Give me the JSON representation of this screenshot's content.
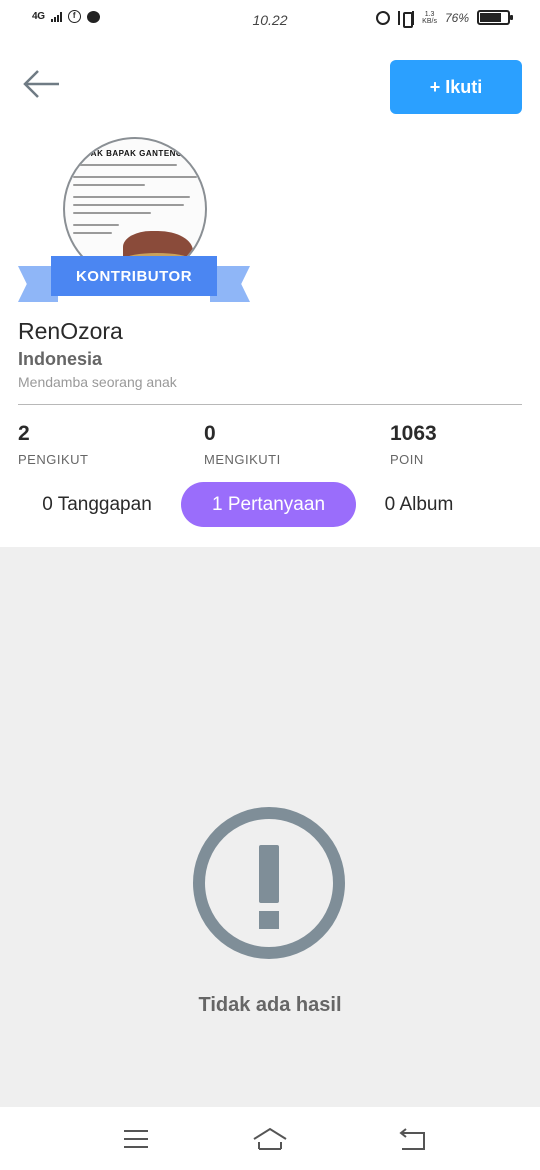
{
  "status_bar": {
    "network": "4G",
    "fb_icon": "f",
    "time": "10.22",
    "speed_top": "1.3",
    "speed_bottom": "KB/s",
    "battery_pct": "76%",
    "battery_level": 0.76
  },
  "header": {
    "back_icon": "arrow-left-icon",
    "follow_label": "+ Ikuti"
  },
  "profile": {
    "avatar_text": "BAPAK BAPAK GANTENG",
    "badge": "KONTRIBUTOR",
    "username": "RenOzora",
    "country": "Indonesia",
    "bio": "Mendamba seorang anak"
  },
  "stats": [
    {
      "value": "2",
      "label": "PENGIKUT"
    },
    {
      "value": "0",
      "label": "MENGIKUTI"
    },
    {
      "value": "1063",
      "label": "POIN"
    }
  ],
  "tabs": [
    {
      "label": "0 Tanggapan",
      "active": false
    },
    {
      "label": "1 Pertanyaan",
      "active": true
    },
    {
      "label": "0 Album",
      "active": false
    }
  ],
  "empty_state": {
    "icon": "exclamation-circle-icon",
    "text": "Tidak ada hasil"
  },
  "nav_bar": {
    "menu_icon": "menu-icon",
    "home_icon": "home-icon",
    "back_icon": "return-icon"
  },
  "colors": {
    "follow_button": "#2ba0ff",
    "active_tab": "#9a6dfb",
    "badge": "#4b86f2",
    "content_bg": "#efefef",
    "empty_icon": "#7f8e98"
  }
}
